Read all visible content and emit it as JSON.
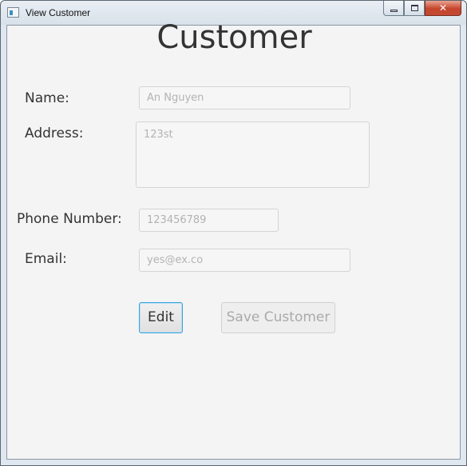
{
  "window": {
    "title": "View Customer",
    "minimize_symbol": "",
    "maximize_symbol": "",
    "close_symbol": "✕"
  },
  "form": {
    "heading": "Customer",
    "name": {
      "label": "Name:",
      "value": "An Nguyen"
    },
    "address": {
      "label": "Address:",
      "value": "123st"
    },
    "phone": {
      "label": "Phone Number:",
      "value": "123456789"
    },
    "email": {
      "label": "Email:",
      "value": "yes@ex.co"
    }
  },
  "buttons": {
    "edit": "Edit",
    "save": "Save Customer"
  },
  "colors": {
    "focus_border": "#3aa4dc",
    "close_button": "#c6452c",
    "disabled_text": "#aaaaaa"
  }
}
